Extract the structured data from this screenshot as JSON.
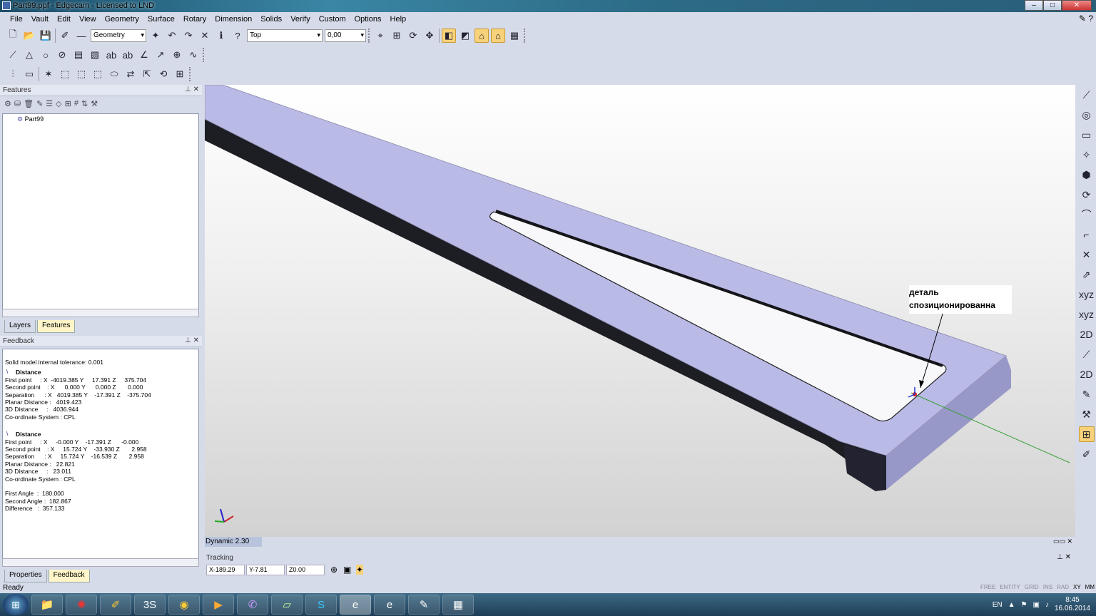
{
  "window": {
    "title": "Part99.ppf - Edgecam - Licensed to LND",
    "min_label": "–",
    "max_label": "□",
    "close_label": "✕"
  },
  "menu": [
    "File",
    "Vault",
    "Edit",
    "View",
    "Geometry",
    "Surface",
    "Rotary",
    "Dimension",
    "Solids",
    "Verify",
    "Custom",
    "Options",
    "Help"
  ],
  "toolbar": {
    "mode_combo": "Geometry",
    "view_combo": "Top",
    "value_combo": "0,00"
  },
  "features_panel": {
    "title": "Features",
    "tree_root": "Part99",
    "tabs": [
      "Layers",
      "Features"
    ]
  },
  "feedback_panel": {
    "title": "Feedback",
    "tolerance": "Solid model internal tolerance: 0.001",
    "sections": [
      {
        "heading": "Distance",
        "lines": [
          "First point     : X  -4019.385 Y     17.391 Z     375.704",
          "Second point    : X      0.000 Y      0.000 Z       0.000",
          "Separation      : X   4019.385 Y    -17.391 Z    -375.704",
          "Planar Distance :   4019.423",
          "3D Distance     :   4036.944",
          "Co-ordinate System : CPL"
        ]
      },
      {
        "heading": "Distance",
        "lines": [
          "First point     : X     -0.000 Y    -17.391 Z      -0.000",
          "Second point    : X     15.724 Y    -33.930 Z       2.958",
          "Separation      : X     15.724 Y    -16.539 Z       2.958",
          "Planar Distance :   22.821",
          "3D Distance     :   23.011",
          "Co-ordinate System : CPL"
        ]
      },
      {
        "heading": "",
        "lines": [
          "First Angle  :  180.000",
          "Second Angle :  182.867",
          "Difference   :  357.133"
        ]
      }
    ],
    "tabs": [
      "Properties",
      "Feedback"
    ]
  },
  "viewport": {
    "annotation_line1": "деталь",
    "annotation_line2": "спозиционированна",
    "dynamic_label": "Dynamic 2.30",
    "part_top_color": "#babae6",
    "part_side_color": "#1d1d24"
  },
  "tracking": {
    "title": "Tracking",
    "x": "X-189.29",
    "y": "Y-7.81",
    "z": "Z0.00"
  },
  "status": {
    "text": "Ready",
    "indicators": [
      "FREE",
      "ENTITY",
      "GRID",
      "INS",
      "RAD",
      "XY",
      "MM"
    ]
  },
  "taskbar": {
    "lang": "EN",
    "time": "8:45",
    "date": "16.06.2014"
  }
}
